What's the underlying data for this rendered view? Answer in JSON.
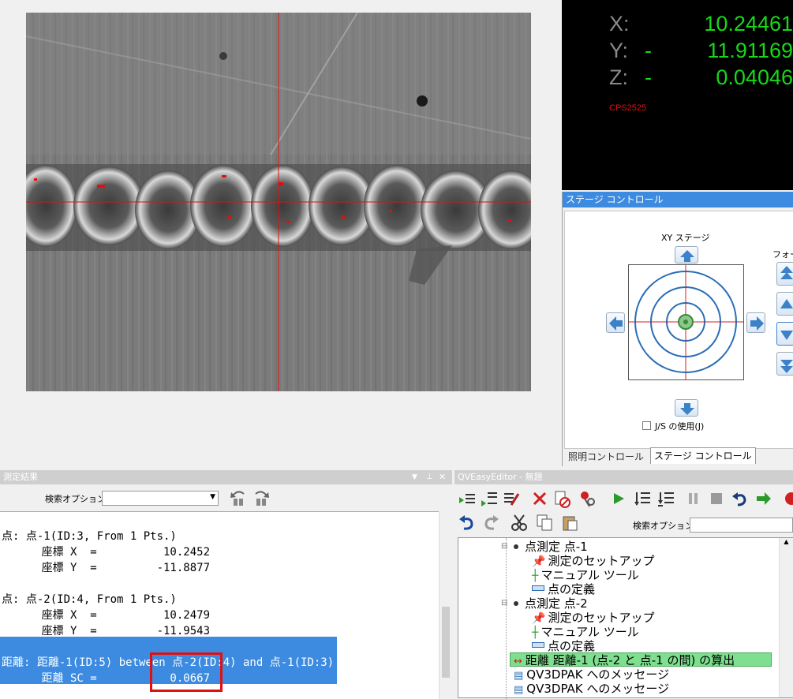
{
  "dro": {
    "x_label": "X:",
    "x_sign": "",
    "x_value": "10.24461",
    "y_label": "Y:",
    "y_sign": "-",
    "y_value": "11.91169",
    "z_label": "Z:",
    "z_sign": "-",
    "z_value": "0.04046",
    "model": "CPS2525"
  },
  "stage": {
    "title": "ステージ コントロール",
    "xy_label": "XY ステージ",
    "focus_label": "フォーカス",
    "js_label": "J/S の使用(J)",
    "tabs": [
      "照明コントロール",
      "ステージ コントロール"
    ]
  },
  "results": {
    "title": "測定結果",
    "search_label": "検索オプション:",
    "lines": [
      "点: 点-1(ID:3, From 1 Pts.)",
      "      座標 X  =          10.2452",
      "      座標 Y  =         -11.8877",
      "",
      "点: 点-2(ID:4, From 1 Pts.)",
      "      座標 X  =          10.2479",
      "      座標 Y  =         -11.9543",
      "",
      "距離: 距離-1(ID:5) between 点-2(ID:4) and 点-1(ID:3)",
      "      距離 SC =           0.0667"
    ]
  },
  "editor": {
    "title": "QVEasyEditor - 無題",
    "search_label": "検索オプション:",
    "tree": [
      {
        "text": "点測定 点-1",
        "level": 0,
        "icon": "bullet"
      },
      {
        "text": "測定のセットアップ",
        "level": 1,
        "icon": "pin-icon"
      },
      {
        "text": "マニュアル ツール",
        "level": 1,
        "icon": "crosshair-icon"
      },
      {
        "text": "点の定義",
        "level": 1,
        "icon": "dash-icon"
      },
      {
        "text": "点測定 点-2",
        "level": 0,
        "icon": "bullet"
      },
      {
        "text": "測定のセットアップ",
        "level": 1,
        "icon": "pin-icon"
      },
      {
        "text": "マニュアル ツール",
        "level": 1,
        "icon": "crosshair-icon"
      },
      {
        "text": "点の定義",
        "level": 1,
        "icon": "dash-icon"
      },
      {
        "text": "距離 距離-1 (点-2 と 点-1 の間) の算出",
        "level": 0,
        "icon": "distance-icon"
      },
      {
        "text": "QV3DPAK へのメッセージ",
        "level": 0,
        "icon": "message-icon"
      },
      {
        "text": "QV3DPAK へのメッセージ",
        "level": 0,
        "icon": "message-icon"
      }
    ]
  },
  "colors": {
    "dro_green": "#18d818",
    "crosshair_red": "#e01010",
    "selection_blue": "#3d8be0",
    "tree_highlight": "#7ee08e"
  }
}
